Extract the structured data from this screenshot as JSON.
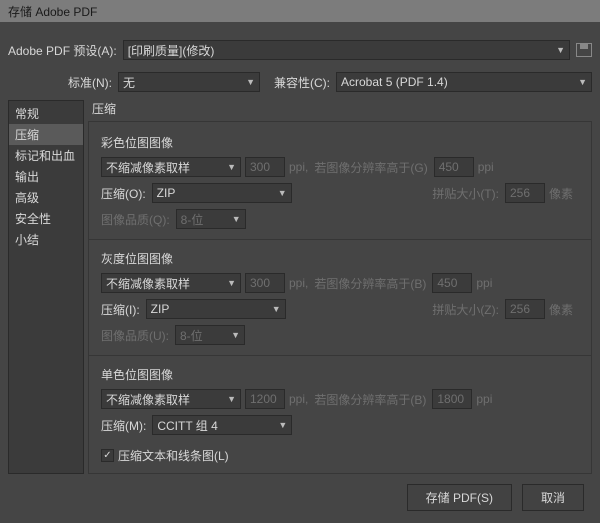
{
  "window": {
    "title": "存储 Adobe PDF"
  },
  "preset": {
    "label": "Adobe PDF 预设(A):",
    "value": "[印刷质量](修改)"
  },
  "standard": {
    "label": "标准(N):",
    "value": "无"
  },
  "compat": {
    "label": "兼容性(C):",
    "value": "Acrobat 5 (PDF 1.4)"
  },
  "sidebar": {
    "items": [
      {
        "label": "常规"
      },
      {
        "label": "压缩"
      },
      {
        "label": "标记和出血"
      },
      {
        "label": "输出"
      },
      {
        "label": "高级"
      },
      {
        "label": "安全性"
      },
      {
        "label": "小结"
      }
    ],
    "selected": 1
  },
  "panel": {
    "title": "压缩"
  },
  "color": {
    "title": "彩色位图图像",
    "downsample": "不缩减像素取样",
    "ppi1": "300",
    "ppi_unit": "ppi,",
    "above_label": "若图像分辨率高于(G)",
    "ppi2": "450",
    "ppi_unit2": "ppi",
    "comp_label": "压缩(O):",
    "comp_value": "ZIP",
    "tile_label": "拼贴大小(T):",
    "tile_value": "256",
    "tile_unit": "像素",
    "quality_label": "图像品质(Q):",
    "quality_value": "8-位"
  },
  "gray": {
    "title": "灰度位图图像",
    "downsample": "不缩减像素取样",
    "ppi1": "300",
    "ppi_unit": "ppi,",
    "above_label": "若图像分辨率高于(B)",
    "ppi2": "450",
    "ppi_unit2": "ppi",
    "comp_label": "压缩(I):",
    "comp_value": "ZIP",
    "tile_label": "拼贴大小(Z):",
    "tile_value": "256",
    "tile_unit": "像素",
    "quality_label": "图像品质(U):",
    "quality_value": "8-位"
  },
  "mono": {
    "title": "单色位图图像",
    "downsample": "不缩减像素取样",
    "ppi1": "1200",
    "ppi_unit": "ppi,",
    "above_label": "若图像分辨率高于(B)",
    "ppi2": "1800",
    "ppi_unit2": "ppi",
    "comp_label": "压缩(M):",
    "comp_value": "CCITT 组 4"
  },
  "compress_text": {
    "checked": true,
    "label": "压缩文本和线条图(L)"
  },
  "footer": {
    "save": "存储 PDF(S)",
    "cancel": "取消"
  }
}
